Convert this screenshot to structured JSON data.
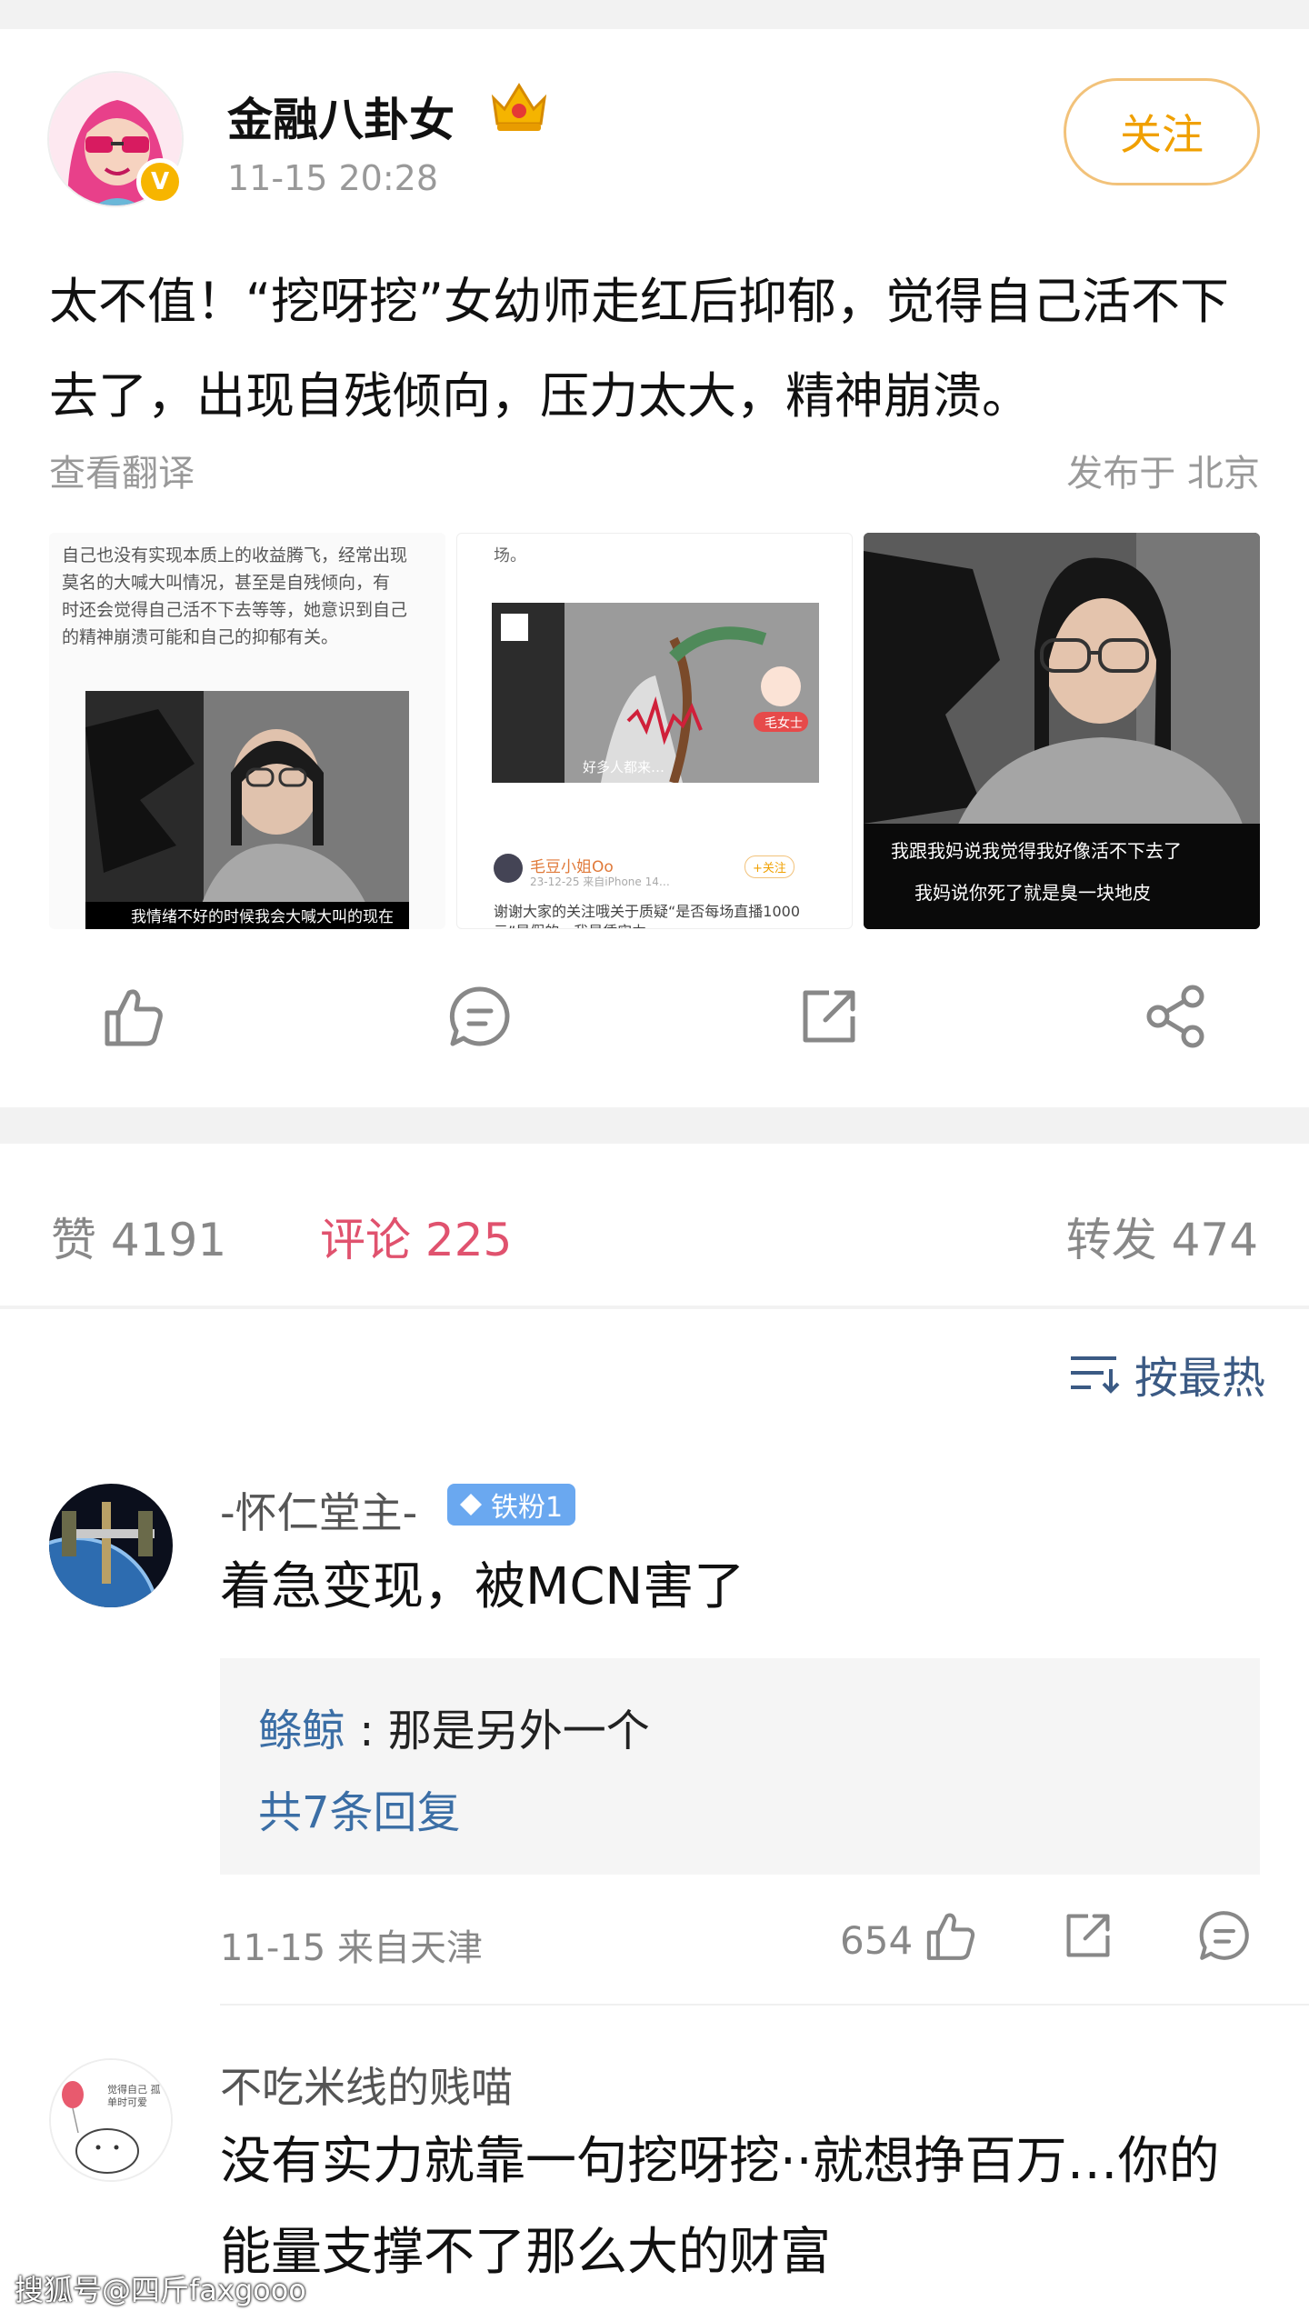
{
  "post": {
    "username": "金融八卦女",
    "time": "11-15 20:28",
    "follow_label": "关注",
    "verified_mark": "V",
    "text": "太不值！“挖呀挖”女幼师走红后抑郁，觉得自己活不下去了，出现自残倾向，压力太大，精神崩溃。",
    "translate_label": "查看翻译",
    "location": "发布于 北京",
    "images": [
      {
        "text_lines": [
          "自己也没有实现本质上的收益腾飞，经常出现",
          "莫名的大喊大叫情况，甚至是自残倾向，有",
          "时还会觉得自己活不下去等等，她意识到自己",
          "的精神崩溃可能和自己的抑郁有关。"
        ],
        "caption": "我情绪不好的时候我会大喊大叫的现在"
      },
      {
        "top_text": "场。",
        "video_caption": "好多人都来…",
        "chip_label": "毛女士",
        "account_name": "毛豆小姐Oo",
        "account_meta": "23-12-25 来自iPhone 14…",
        "follow_chip": "+关注",
        "body_line1": "谢谢大家的关注哦关于质疑“是否每场直播1000",
        "body_line2": "元”是假的，我是凭实力…"
      },
      {
        "caption_line1": "我跟我妈说我觉得我好像活不下去了",
        "caption_line2": "我妈说你死了就是臭一块地皮"
      }
    ]
  },
  "actions": {
    "like_icon": "thumbs-up-icon",
    "comment_icon": "comment-icon",
    "repost_icon": "repost-icon",
    "share_icon": "share-icon"
  },
  "stats": {
    "likes": "赞 4191",
    "comments": "评论 225",
    "reposts": "转发 474"
  },
  "sort": {
    "label": "按最热",
    "icon": "sort-icon"
  },
  "comments": [
    {
      "name": "-怀仁堂主-",
      "badge": "铁粉1",
      "text": "着急变现，被MCN害了",
      "reply_author": "鲦鲸",
      "reply_text": " : 那是另外一个",
      "reply_more": "共7条回复",
      "meta": "11-15  来自天津",
      "like_count": "654"
    },
    {
      "name": "不吃米线的贱喵",
      "avatar_text": "觉得自己 孤单时可爱",
      "text_line1": "没有实力就靠一句挖呀挖··就想挣百万…你的",
      "text_line2": "能量支撑不了那么大的财富"
    }
  ],
  "watermark": "搜狐号@四斤faxgooo",
  "colors": {
    "accent_follow": "#f0a000",
    "comment_active": "#e0526e",
    "link_blue": "#3b6ea5",
    "fan_badge": "#6aa8f0"
  }
}
